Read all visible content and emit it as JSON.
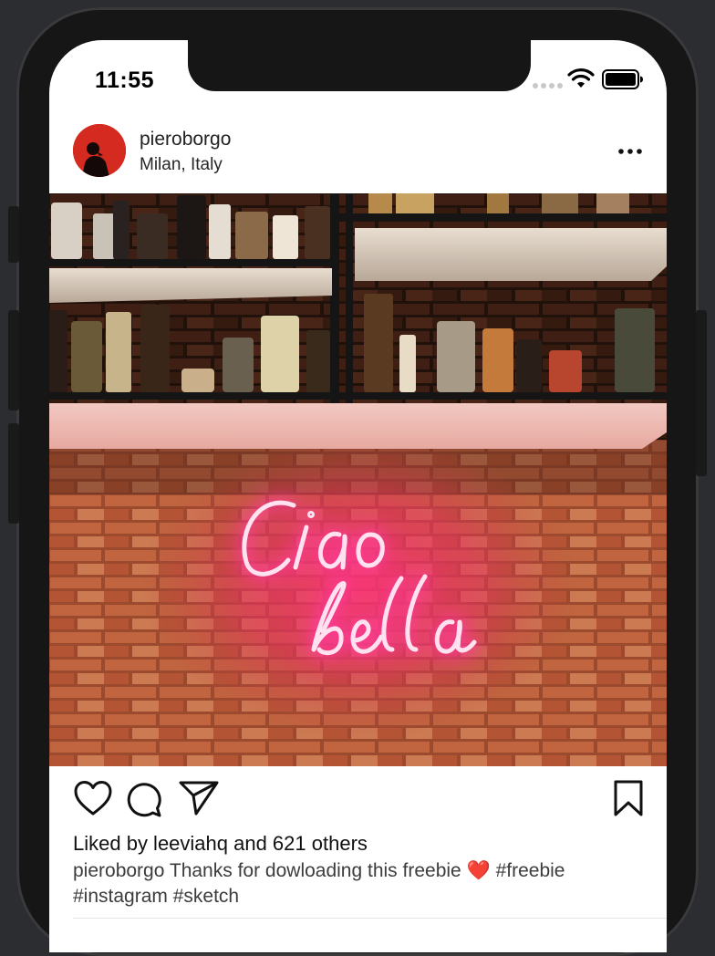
{
  "status_bar": {
    "time": "11:55",
    "icons": [
      "signal-icon",
      "wifi-icon",
      "battery-icon"
    ]
  },
  "post": {
    "username": "pieroborgo",
    "location": "Milan, Italy",
    "image_neon_text": "Ciao bella",
    "likes_text": "Liked by leeviahq and 621 others",
    "caption": {
      "username": "pieroborgo",
      "text": "Thanks for dowloading this freebie",
      "emoji": "❤️",
      "tags_line1": "#freebie",
      "tags_line2": "#instagram #sketch"
    }
  },
  "actions": {
    "icons": [
      "heart-icon",
      "comment-icon",
      "share-icon",
      "bookmark-icon"
    ]
  },
  "colors": {
    "neon": "#ff3b9a",
    "brick": "#b5583a",
    "avatar_bg": "#d42a1f",
    "text_primary": "#111111",
    "text_secondary": "#3c3c3c"
  }
}
